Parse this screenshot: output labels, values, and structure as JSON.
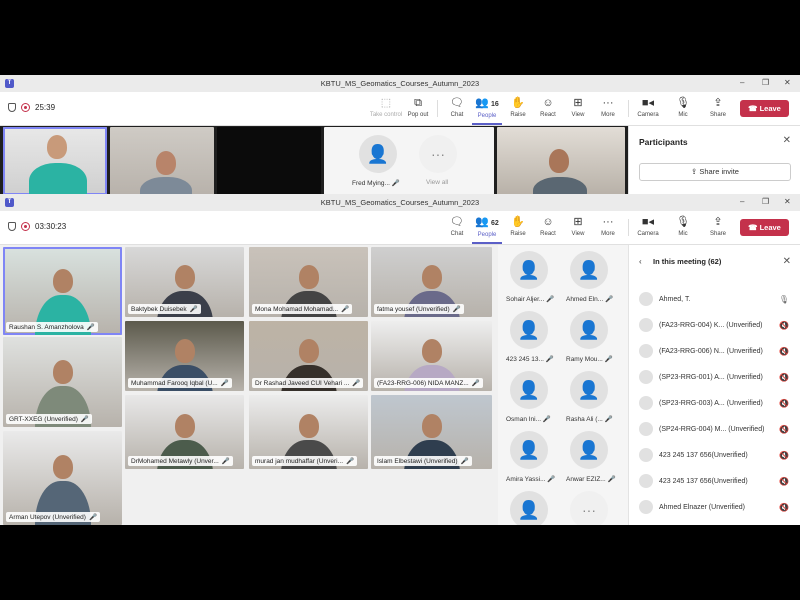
{
  "window1": {
    "title": "KBTU_MS_Geomatics_Courses_Autumn_2023",
    "timer": "25:39",
    "toolbar": {
      "take_control": "Take control",
      "pop_out": "Pop out",
      "chat": "Chat",
      "people": "People",
      "people_count": "16",
      "raise": "Raise",
      "react": "React",
      "view": "View",
      "more": "More",
      "camera": "Camera",
      "mic": "Mic",
      "share": "Share",
      "leave": "Leave"
    },
    "tiles": {
      "fred": "Fred Mying...",
      "view_all": "View all"
    },
    "panel": {
      "title": "Participants",
      "share_invite": "Share invite"
    }
  },
  "window2": {
    "title": "KBTU_MS_Geomatics_Courses_Autumn_2023",
    "timer": "03:30:23",
    "toolbar": {
      "chat": "Chat",
      "people": "People",
      "people_count": "62",
      "raise": "Raise",
      "react": "React",
      "view": "View",
      "more": "More",
      "camera": "Camera",
      "mic": "Mic",
      "share": "Share",
      "leave": "Leave"
    },
    "grid": [
      "Raushan S. Amanzholova",
      "Baktybek Duisebek",
      "Mona Mohamad Mohamad...",
      "fatma yousef (Unverified)",
      "GRT-XXEG (Unverified)",
      "Muhammad Farooq Iqbal (U...",
      "Dr Rashad Javeed CUI Vehari ...",
      "(FA23-RRG-006) NIDA MANZ...",
      "DrMohamed Metawly (Unver...",
      "murad jan mudhaffar (Unveri...",
      "Islam Elbestawi (Unverified)",
      "Arman Utepov (Unverified)"
    ],
    "avatars": [
      "Sohair Aljer...",
      "Ahmed Eln...",
      "423 245 13...",
      "Ramy Mou...",
      "Osman Ini...",
      "Rasha Ali (...",
      "Amira Yassi...",
      "Anwar EZIZ..."
    ],
    "panel": {
      "title": "In this meeting (62)",
      "participants": [
        "Ahmed, T.",
        "(FA23-RRG-004) K... (Unverified)",
        "(FA23-RRG-006) N... (Unverified)",
        "(SP23-RRG-001) A... (Unverified)",
        "(SP23-RRG-003) A... (Unverified)",
        "(SP24-RRG-004) M... (Unverified)",
        "423 245 137 656(Unverified)",
        "423 245 137 656(Unverified)",
        "Ahmed Elnazer (Unverified)"
      ]
    }
  }
}
